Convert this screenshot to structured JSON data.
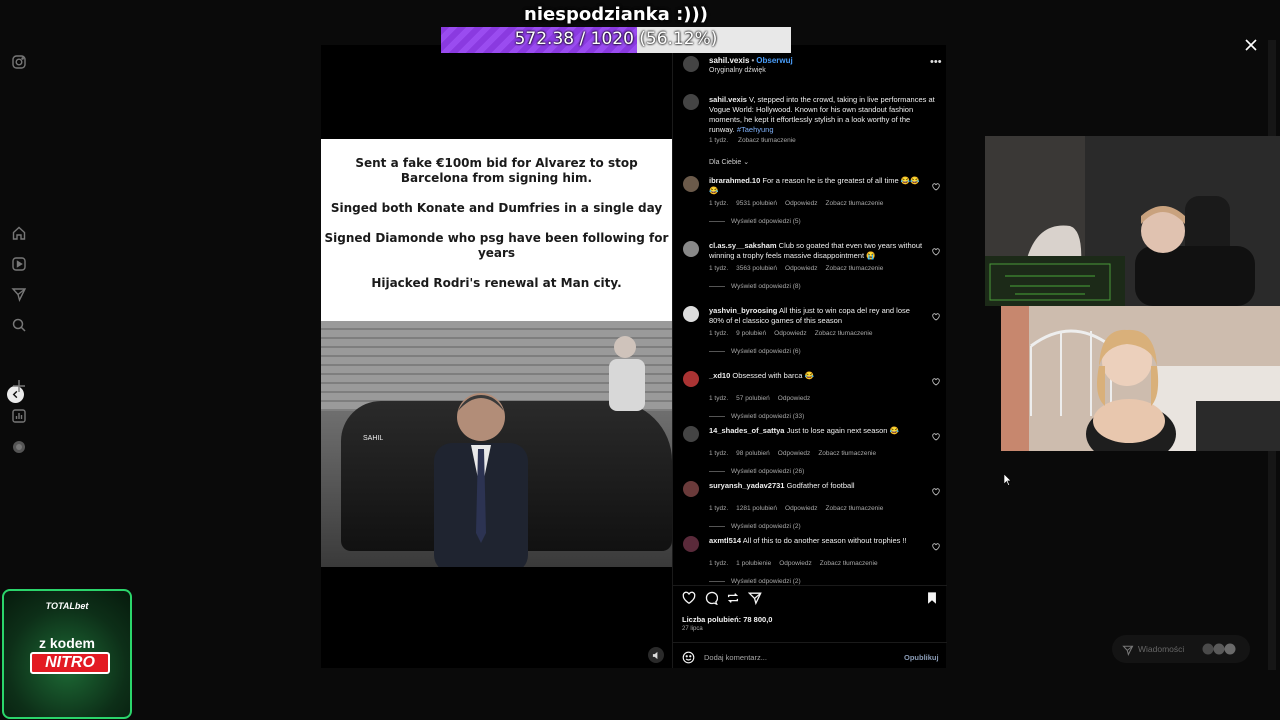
{
  "overlay": {
    "title": "niespodzianka :)))",
    "goal_text": "572.38 / 1020 (56.12%)",
    "goal_fraction": 0.5612,
    "goal_color": "#8a3ae0"
  },
  "left_rail": {
    "icons": [
      "instagram-icon",
      "home-icon",
      "reels-icon",
      "messages-icon",
      "search-icon",
      "back-icon",
      "create-icon",
      "dashboard-icon",
      "profile-icon"
    ]
  },
  "post": {
    "image_text": [
      "Sent a fake €100m bid for Alvarez to stop Barcelona from signing him.",
      "Singed both Konate and Dumfries in a single day",
      "Signed Diamonde who psg have been following for years",
      "Hijacked Rodri's renewal at Man city."
    ],
    "watermark": "SAHIL"
  },
  "panel": {
    "username": "sahil.vexis",
    "follow_label": "Obserwuj",
    "audio": "Oryginalny dźwięk",
    "caption_user": "sahil.vexis",
    "caption_text": "V, stepped into the crowd, taking in live performances at Vogue World: Hollywood. Known for his own standout fashion moments, he kept it effortlessly stylish in a look worthy of the runway.",
    "caption_tag": "#Taehyung",
    "caption_time": "1 tydz.",
    "caption_translate": "Zobacz tłumaczenie",
    "sort_label": "Dla Ciebie",
    "comments": [
      {
        "user": "ibrarahmed.10",
        "text": "For a reason he is the greatest of all time 😂😂😂",
        "time": "1 tydz.",
        "likes": "9531 polubień",
        "reply": "Odpowiedz",
        "translate": "Zobacz tłumaczenie",
        "replies": "Wyświetl odpowiedzi (5)"
      },
      {
        "user": "cl.as.sy__saksham",
        "text": "Club so goated that even two years without winning a trophy feels massive disappointment 😭",
        "time": "1 tydz.",
        "likes": "3563 polubień",
        "reply": "Odpowiedz",
        "translate": "Zobacz tłumaczenie",
        "replies": "Wyświetl odpowiedzi (8)"
      },
      {
        "user": "yashvin_byroosing",
        "text": "All this just to win copa del rey and lose 80% of el classico games of this season",
        "time": "1 tydz.",
        "likes": "9 polubień",
        "reply": "Odpowiedz",
        "translate": "Zobacz tłumaczenie",
        "replies": "Wyświetl odpowiedzi (6)"
      },
      {
        "user": "_xd10",
        "text": "Obsessed with barca 😂",
        "time": "1 tydz.",
        "likes": "57 polubień",
        "reply": "Odpowiedz",
        "translate": "",
        "replies": "Wyświetl odpowiedzi (33)"
      },
      {
        "user": "14_shades_of_sattya",
        "text": "Just to lose again next season 😂",
        "time": "1 tydz.",
        "likes": "98 polubień",
        "reply": "Odpowiedz",
        "translate": "Zobacz tłumaczenie",
        "replies": "Wyświetl odpowiedzi (26)"
      },
      {
        "user": "suryansh_yadav2731",
        "text": "Godfather of football",
        "time": "1 tydz.",
        "likes": "1281 polubień",
        "reply": "Odpowiedz",
        "translate": "Zobacz tłumaczenie",
        "replies": "Wyświetl odpowiedzi (2)"
      },
      {
        "user": "axmtl514",
        "text": "All of this to do another season without trophies !!",
        "time": "1 tydz.",
        "likes": "1 polubienie",
        "reply": "Odpowiedz",
        "translate": "Zobacz tłumaczenie",
        "replies": "Wyświetl odpowiedzi (2)"
      }
    ],
    "likes_label": "Liczba polubień: 78 800,0",
    "date": "27 lipca",
    "comment_placeholder": "Dodaj komentarz...",
    "publish_label": "Opublikuj"
  },
  "notifications": {
    "label": "Wiadomości"
  },
  "ad": {
    "brand": "TOTALbet",
    "line1": "z kodem",
    "line2": "NITRO",
    "border_color": "#2bd56b"
  }
}
